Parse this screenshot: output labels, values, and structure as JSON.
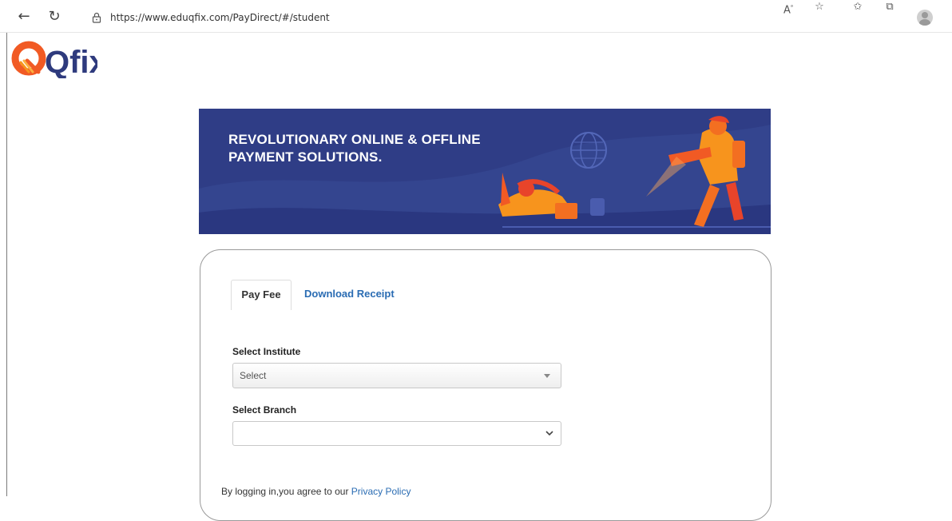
{
  "browser": {
    "url": "https://www.eduqfix.com/PayDirect/#/student",
    "icons": [
      "back-icon",
      "refresh-icon",
      "lock-icon",
      "read-aloud-icon",
      "add-favorite-icon",
      "favorites-icon",
      "collections-icon",
      "profile-icon"
    ]
  },
  "logo": {
    "text": "Qfix"
  },
  "banner": {
    "line1": "REVOLUTIONARY ONLINE & OFFLINE",
    "line2": "PAYMENT SOLUTIONS."
  },
  "tabs": {
    "pay_fee": "Pay Fee",
    "download_receipt": "Download Receipt"
  },
  "form": {
    "institute_label": "Select Institute",
    "institute_value": "Select",
    "branch_label": "Select Branch",
    "branch_value": ""
  },
  "footer": {
    "prefix": "By logging in,you agree to our ",
    "link": "Privacy Policy"
  },
  "colors": {
    "banner_bg": "#2f3d86",
    "brand_orange": "#f15a24",
    "link_blue": "#2a6cb3"
  }
}
